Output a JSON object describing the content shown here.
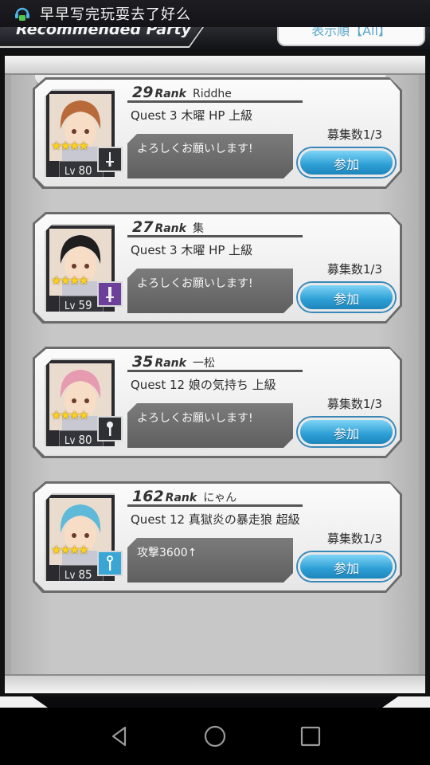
{
  "status_bar": {
    "text": "早早写完玩耍去了好么",
    "icon": "game-assistant-icon"
  },
  "header": {
    "tab_label": "Recommended Party",
    "sort_label": "表示順【All】"
  },
  "cards": [
    {
      "rank": "29",
      "rank_label": "Rank",
      "host": "Riddhe",
      "quest": "Quest 3 木曜 HP 上級",
      "message": "よろしくお願いします!",
      "recruit": "募集数1/3",
      "join_label": "参加",
      "level_label": "Lv",
      "level": "80",
      "stars": "★★★★",
      "weapon_icon": "rapier-icon",
      "weapon_color": "#2f3034",
      "hair_color": "#b86a3a"
    },
    {
      "rank": "27",
      "rank_label": "Rank",
      "host": "集",
      "quest": "Quest 3 木曜 HP 上級",
      "message": "よろしくお願いします!",
      "recruit": "募集数1/3",
      "join_label": "参加",
      "level_label": "Lv",
      "level": "59",
      "stars": "★★★★",
      "weapon_icon": "sword-icon",
      "weapon_color": "#6b3f9a",
      "hair_color": "#1e1e1e"
    },
    {
      "rank": "35",
      "rank_label": "Rank",
      "host": "一松",
      "quest": "Quest 12 娘の気持ち 上級",
      "message": "よろしくお願いします!",
      "recruit": "募集数1/3",
      "join_label": "参加",
      "level_label": "Lv",
      "level": "80",
      "stars": "★★★★",
      "weapon_icon": "mace-icon",
      "weapon_color": "#2f3034",
      "hair_color": "#e79bb0"
    },
    {
      "rank": "162",
      "rank_label": "Rank",
      "host": "にゃん",
      "quest": "Quest 12 真獄炎の暴走狼 超級",
      "message": "攻撃3600↑",
      "recruit": "募集数1/3",
      "join_label": "参加",
      "level_label": "Lv",
      "level": "85",
      "stars": "★★★★",
      "weapon_icon": "staff-icon",
      "weapon_color": "#3aa6d6",
      "hair_color": "#5fb9d8"
    }
  ],
  "nav": {
    "back_icon": "back-triangle-icon",
    "home_icon": "home-circle-icon",
    "recents_icon": "recents-square-icon"
  }
}
